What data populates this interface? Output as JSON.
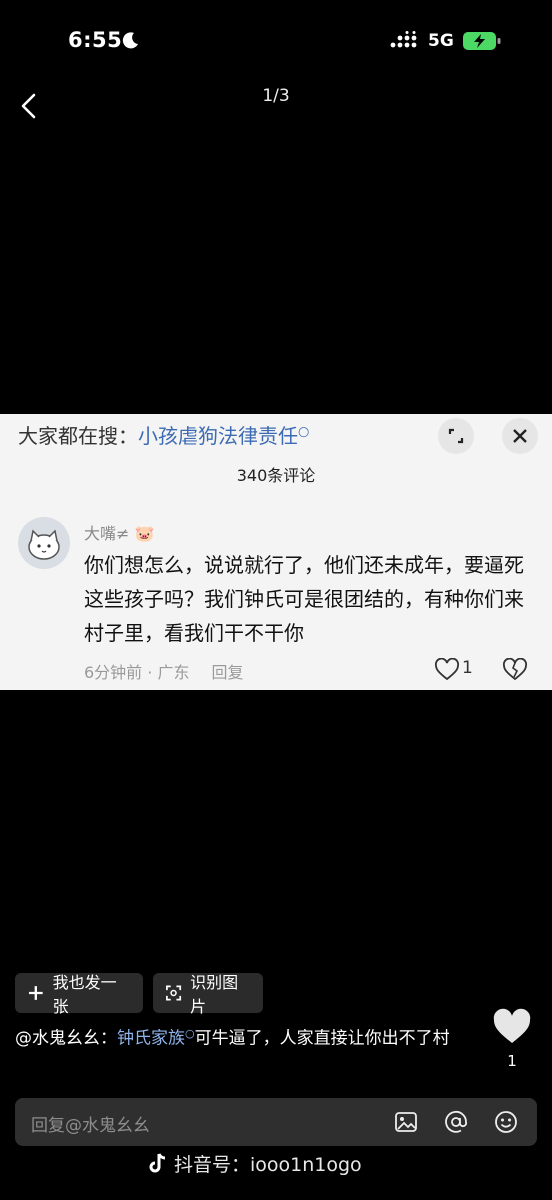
{
  "status_bar": {
    "time": "6:55",
    "network": "5G",
    "battery_icon": "battery-charging-icon"
  },
  "header": {
    "page_indicator": "1/3"
  },
  "embedded_screenshot": {
    "search_prefix": "大家都在搜：",
    "search_keyword": "小孩虐狗法律责任",
    "comment_count": "340条评论",
    "username": "大嘴≠",
    "comment_text": "你们想怎么，说说就行了，他们还未成年，要逼死这些孩子吗？我们钟氏可是很团结的，有种你们来村子里，看我们干不干你",
    "time_ago": "6分钟前 · 广东",
    "reply_label": "回复",
    "like_count": "1"
  },
  "actions": {
    "post_label": "我也发一张",
    "recognize_label": "识别图片"
  },
  "caption": {
    "author": "@水鬼幺幺：",
    "tag": "钟氏家族",
    "text": "可牛逼了，人家直接让你出不了村"
  },
  "like": {
    "count": "1"
  },
  "reply_bar": {
    "placeholder": "回复@水鬼幺幺"
  },
  "watermark": {
    "text": "抖音号：iooo1n1ogo"
  },
  "colors": {
    "background": "#000000",
    "link_blue": "#3d6bb3",
    "battery_green": "#4cd964"
  }
}
